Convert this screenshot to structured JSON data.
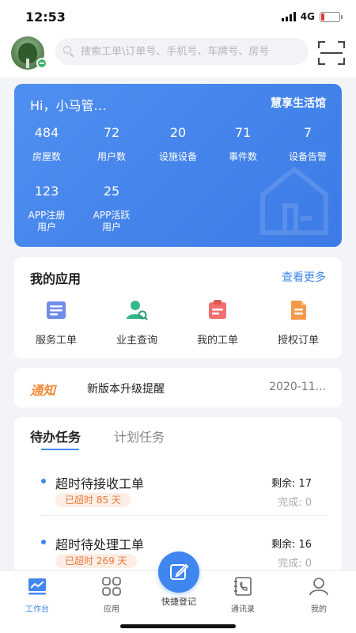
{
  "status_bar": {
    "time": "12:53",
    "network": "4G"
  },
  "header": {
    "search_placeholder": "搜索工单\\订单号、手机号、车牌号、房号",
    "avatar": "avatar-image",
    "scan_icon": "scan-icon"
  },
  "stats": {
    "greeting": "Hi，小马管…",
    "community": "慧享生活馆",
    "items": [
      {
        "value": "484",
        "label": "房屋数"
      },
      {
        "value": "72",
        "label": "用户数"
      },
      {
        "value": "20",
        "label": "设施设备"
      },
      {
        "value": "71",
        "label": "事件数"
      },
      {
        "value": "7",
        "label": "设备告警"
      },
      {
        "value": "123",
        "label_line1": "APP注册",
        "label_line2": "用户"
      },
      {
        "value": "25",
        "label_line1": "APP活跃",
        "label_line2": "用户"
      }
    ]
  },
  "apps": {
    "title": "我的应用",
    "more": "查看更多",
    "items": [
      {
        "label": "服务工单",
        "icon": "service-order-icon"
      },
      {
        "label": "业主查询",
        "icon": "owner-search-icon"
      },
      {
        "label": "我的工单",
        "icon": "my-order-icon"
      },
      {
        "label": "授权订单",
        "icon": "authorized-order-icon"
      }
    ]
  },
  "notice": {
    "tag": "通知",
    "text": "新版本升级提醒",
    "date": "2020-11..."
  },
  "tasks": {
    "tabs": [
      "待办任务",
      "计划任务"
    ],
    "items": [
      {
        "title": "超时待接收工单",
        "overdue": "已超时 85 天",
        "remaining": "剩余: 17",
        "done": "完成: 0"
      },
      {
        "title": "超时待处理工单",
        "overdue": "已超时 269 天",
        "remaining": "剩余: 16",
        "done": "完成: 0"
      }
    ]
  },
  "tabbar": {
    "items": [
      {
        "label": "工作台",
        "icon": "dashboard-icon"
      },
      {
        "label": "应用",
        "icon": "apps-grid-icon"
      },
      {
        "label": "快捷登记",
        "icon": "edit-icon"
      },
      {
        "label": "通讯录",
        "icon": "contacts-icon"
      },
      {
        "label": "我的",
        "icon": "profile-icon"
      }
    ]
  },
  "colors": {
    "primary": "#3f86ef",
    "card_gradient_start": "#4f8ff0",
    "notice_accent": "#f08a3c",
    "overdue_bg": "#fdeee5",
    "battery_low": "#e53935"
  }
}
